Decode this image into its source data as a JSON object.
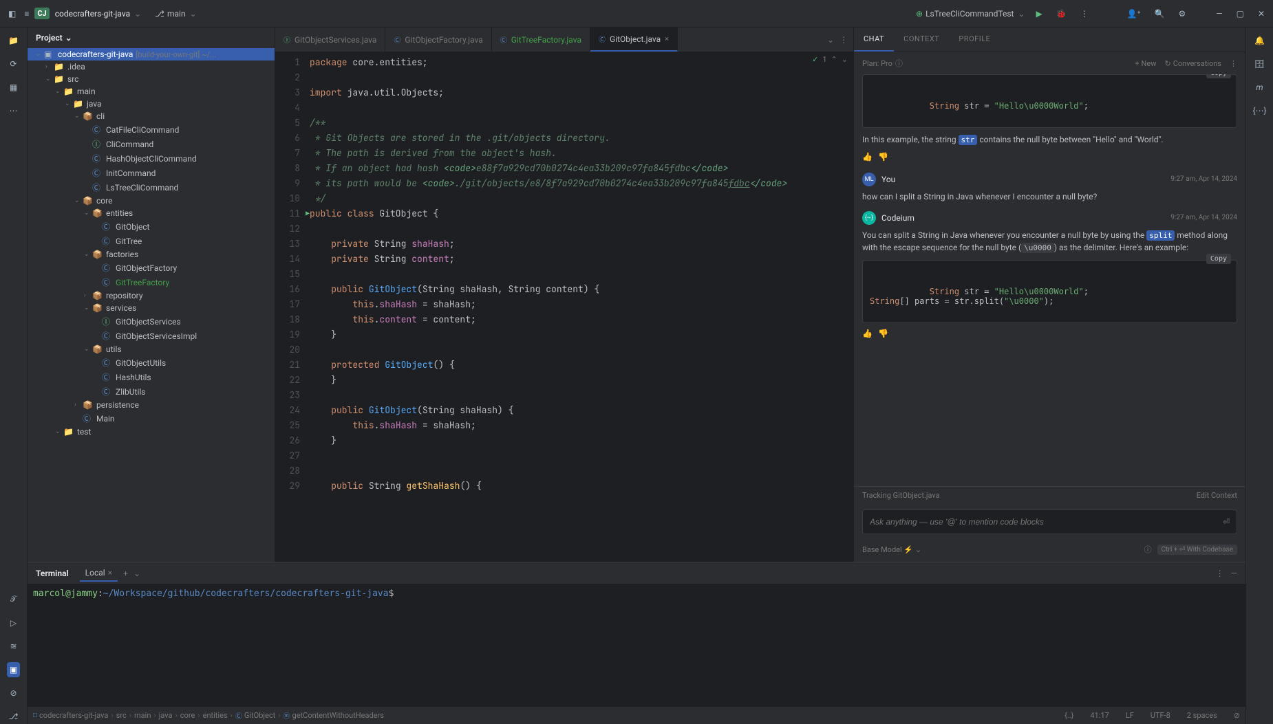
{
  "titlebar": {
    "project_badge": "CJ",
    "project_name": "codecrafters-git-java",
    "branch_icon": "⎇",
    "branch": "main",
    "run_config": "LsTreeCliCommandTest",
    "menu_icon": "≡",
    "app_icon": "⬛"
  },
  "project": {
    "header": "Project",
    "root_label": "codecrafters-git-java",
    "root_hint": "[build-your-own-git] ~/...",
    "items": [
      {
        "indent": 1,
        "chev": "›",
        "icon": "📁",
        "label": ".idea"
      },
      {
        "indent": 1,
        "chev": "⌄",
        "icon": "📁",
        "label": "src"
      },
      {
        "indent": 2,
        "chev": "⌄",
        "icon": "📁",
        "label": "main"
      },
      {
        "indent": 3,
        "chev": "⌄",
        "icon": "📁",
        "label": "java"
      },
      {
        "indent": 4,
        "chev": "⌄",
        "icon": "📦",
        "label": "cli"
      },
      {
        "indent": 5,
        "chev": "",
        "icon": "Ⓒ",
        "iconCls": "class",
        "label": "CatFileCliCommand"
      },
      {
        "indent": 5,
        "chev": "",
        "icon": "Ⓘ",
        "iconCls": "interface",
        "label": "CliCommand"
      },
      {
        "indent": 5,
        "chev": "",
        "icon": "Ⓒ",
        "iconCls": "class",
        "label": "HashObjectCliCommand"
      },
      {
        "indent": 5,
        "chev": "",
        "icon": "Ⓒ",
        "iconCls": "class",
        "label": "InitCommand"
      },
      {
        "indent": 5,
        "chev": "",
        "icon": "Ⓒ",
        "iconCls": "class",
        "label": "LsTreeCliCommand"
      },
      {
        "indent": 4,
        "chev": "⌄",
        "icon": "📦",
        "label": "core"
      },
      {
        "indent": 5,
        "chev": "⌄",
        "icon": "📦",
        "label": "entities"
      },
      {
        "indent": 6,
        "chev": "",
        "icon": "Ⓒ",
        "iconCls": "class",
        "label": "GitObject"
      },
      {
        "indent": 6,
        "chev": "",
        "icon": "Ⓒ",
        "iconCls": "class",
        "label": "GitTree"
      },
      {
        "indent": 5,
        "chev": "⌄",
        "icon": "📦",
        "label": "factories"
      },
      {
        "indent": 6,
        "chev": "",
        "icon": "Ⓒ",
        "iconCls": "class",
        "label": "GitObjectFactory"
      },
      {
        "indent": 6,
        "chev": "",
        "icon": "Ⓒ",
        "iconCls": "class",
        "label": "GitTreeFactory",
        "hl": true
      },
      {
        "indent": 5,
        "chev": "›",
        "icon": "📦",
        "label": "repository"
      },
      {
        "indent": 5,
        "chev": "⌄",
        "icon": "📦",
        "label": "services"
      },
      {
        "indent": 6,
        "chev": "",
        "icon": "Ⓘ",
        "iconCls": "interface",
        "label": "GitObjectServices"
      },
      {
        "indent": 6,
        "chev": "",
        "icon": "Ⓒ",
        "iconCls": "class",
        "label": "GitObjectServicesImpl"
      },
      {
        "indent": 5,
        "chev": "⌄",
        "icon": "📦",
        "label": "utils"
      },
      {
        "indent": 6,
        "chev": "",
        "icon": "Ⓒ",
        "iconCls": "class",
        "label": "GitObjectUtils"
      },
      {
        "indent": 6,
        "chev": "",
        "icon": "Ⓒ",
        "iconCls": "class",
        "label": "HashUtils"
      },
      {
        "indent": 6,
        "chev": "",
        "icon": "Ⓒ",
        "iconCls": "class",
        "label": "ZlibUtils"
      },
      {
        "indent": 4,
        "chev": "›",
        "icon": "📦",
        "label": "persistence"
      },
      {
        "indent": 4,
        "chev": "",
        "icon": "Ⓒ",
        "iconCls": "class",
        "label": "Main"
      },
      {
        "indent": 2,
        "chev": "⌄",
        "icon": "📁",
        "label": "test"
      }
    ]
  },
  "tabs": [
    {
      "icon": "Ⓘ",
      "iconCls": "intf",
      "label": "GitObjectServices.java"
    },
    {
      "icon": "Ⓒ",
      "iconCls": "kt",
      "label": "GitObjectFactory.java"
    },
    {
      "icon": "Ⓒ",
      "iconCls": "kt",
      "label": "GitTreeFactory.java",
      "hl": true
    },
    {
      "icon": "Ⓒ",
      "iconCls": "kt",
      "label": "GitObject.java",
      "active": true,
      "close": true
    }
  ],
  "editor_status": {
    "check": "✓",
    "count": "1"
  },
  "code_lines": [
    {
      "n": 1,
      "html": "<span class='kw'>package</span> core.entities;"
    },
    {
      "n": 2,
      "html": ""
    },
    {
      "n": 3,
      "html": "<span class='kw'>import</span> java.util.Objects;"
    },
    {
      "n": 4,
      "html": ""
    },
    {
      "n": 5,
      "html": "<span class='doc'>/**</span>"
    },
    {
      "n": 6,
      "html": "<span class='doc'> * Git Objects are stored in the .git/objects directory.</span>"
    },
    {
      "n": 7,
      "html": "<span class='doc'> * The path is derived from the object's hash.</span>"
    },
    {
      "n": 8,
      "html": "<span class='doc'> * If an object had hash </span><span class='doc-tag'>&lt;code&gt;</span><span class='doc'>e88f7a929cd70b0274c4ea33b209c97fa845fdbc</span><span class='doc-tag'>&lt;/code&gt;</span>"
    },
    {
      "n": 9,
      "html": "<span class='doc'> * its path would be </span><span class='doc-tag'>&lt;code&gt;</span><span class='doc'>./git/objects/e8/8f7a929cd70b0274c4ea33b209c97fa845<u>fdbc</u></span><span class='doc-tag'>&lt;/code&gt;</span>"
    },
    {
      "n": 10,
      "html": "<span class='doc'> */</span>"
    },
    {
      "n": 11,
      "html": "<span class='kw'>public class</span> GitObject {",
      "play": true
    },
    {
      "n": 12,
      "html": ""
    },
    {
      "n": 13,
      "html": "    <span class='kw'>private</span> String <span class='field'>shaHash</span>;"
    },
    {
      "n": 14,
      "html": "    <span class='kw'>private</span> String <span class='field'>content</span>;"
    },
    {
      "n": 15,
      "html": ""
    },
    {
      "n": 16,
      "html": "    <span class='kw'>public</span> <span class='method'>GitObject</span>(String shaHash, String content) {"
    },
    {
      "n": 17,
      "html": "        <span class='kw'>this</span>.<span class='field'>shaHash</span> = shaHash;"
    },
    {
      "n": 18,
      "html": "        <span class='kw'>this</span>.<span class='field'>content</span> = content;"
    },
    {
      "n": 19,
      "html": "    }"
    },
    {
      "n": 20,
      "html": ""
    },
    {
      "n": 21,
      "html": "    <span class='kw'>protected</span> <span class='method'>GitObject</span>() {"
    },
    {
      "n": 22,
      "html": "    }"
    },
    {
      "n": 23,
      "html": ""
    },
    {
      "n": 24,
      "html": "    <span class='kw'>public</span> <span class='method'>GitObject</span>(String shaHash) {"
    },
    {
      "n": 25,
      "html": "        <span class='kw'>this</span>.<span class='field'>shaHash</span> = shaHash;"
    },
    {
      "n": 26,
      "html": "    }"
    },
    {
      "n": 27,
      "html": ""
    },
    {
      "n": 28,
      "html": ""
    },
    {
      "n": 29,
      "html": "    <span class='kw'>public</span> String <span class='mtd2'>getShaHash</span>() {"
    }
  ],
  "chat": {
    "tabs": [
      "CHAT",
      "CONTEXT",
      "PROFILE"
    ],
    "plan": "Plan: Pro",
    "new_btn": "New",
    "conv_btn": "Conversations",
    "copy": "Copy",
    "code1_html": "<span class='cb-kw'>String</span> <span class='cb-id'>str</span> = <span class='cb-str'>\"Hello\\u0000World\"</span>;",
    "text1_a": "In this example, the string ",
    "text1_code": "str",
    "text1_b": " contains the null byte between \"Hello\" and \"World\".",
    "user_name": "You",
    "user_avatar_text": "ML",
    "bot_avatar_text": "{~}",
    "user_time": "9:27 am, Apr 14, 2024",
    "user_msg": "how can I split a String in Java whenever I encounter a null byte?",
    "bot_name": "Codeium",
    "bot_time": "9:27 am, Apr 14, 2024",
    "bot_msg_a": "You can split a String in Java whenever you encounter a null byte by using the ",
    "bot_msg_code1": "split",
    "bot_msg_b": " method along with the escape sequence for the null byte (",
    "bot_msg_code2": "\\u0000",
    "bot_msg_c": ") as the delimiter. Here's an example:",
    "code2_html": "<span class='cb-kw'>String</span> <span class='cb-id'>str</span> = <span class='cb-str'>\"Hello\\u0000World\"</span>;\n<span class='cb-kw'>String</span>[] <span class='cb-id'>parts</span> = str.split(<span class='cb-str'>\"\\u0000\"</span>);",
    "tracking": "Tracking GitObject.java",
    "edit_context": "Edit Context",
    "input_placeholder": "Ask anything — use '@' to mention code blocks",
    "base_model": "Base Model ⚡",
    "codebase_btn": "Ctrl + ⏎ With Codebase"
  },
  "terminal": {
    "title": "Terminal",
    "tab": "Local",
    "user": "marcol@jammy",
    "colon": ":",
    "path": "~/Workspace/github/codecrafters/codecrafters-git-java",
    "dollar": "$"
  },
  "status": {
    "breadcrumb": [
      "codecrafters-git-java",
      "src",
      "main",
      "java",
      "core",
      "entities",
      "GitObject",
      "getContentWithoutHeaders"
    ],
    "bc_icons": [
      "□",
      "",
      "",
      "",
      "",
      "",
      "Ⓒ",
      "ⓜ"
    ],
    "brace": "{..}",
    "pos": "41:17",
    "le": "LF",
    "enc": "UTF-8",
    "indent": "2 spaces",
    "lock": "⊘"
  }
}
